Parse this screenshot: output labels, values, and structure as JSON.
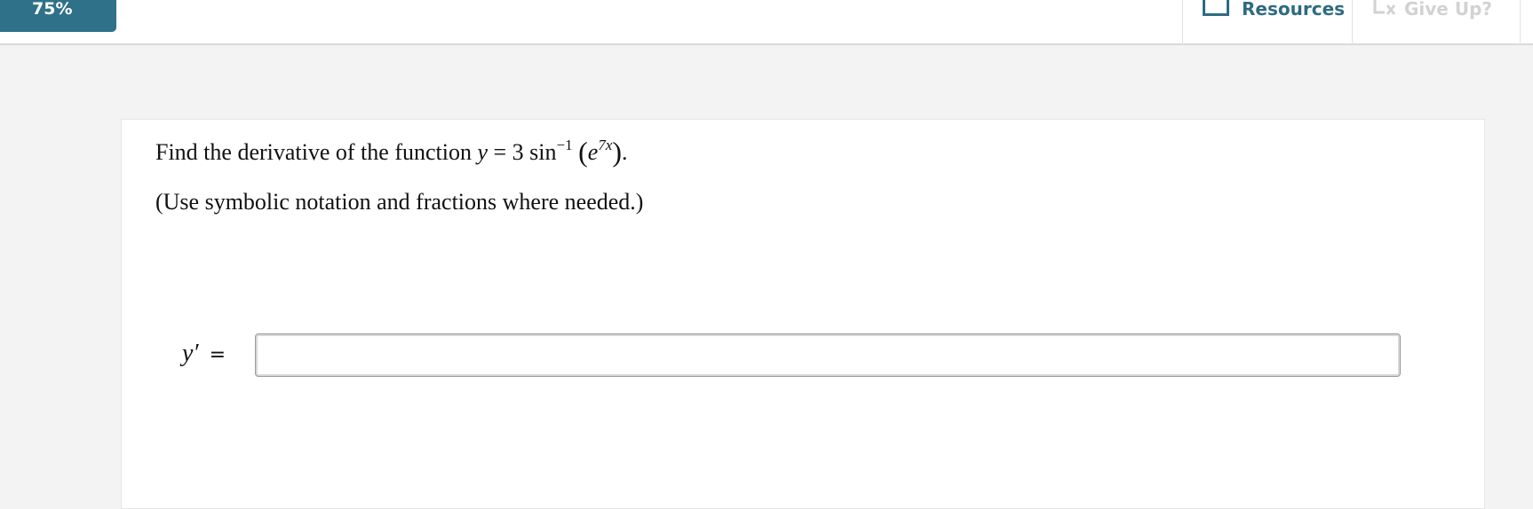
{
  "header": {
    "progress": "75%",
    "resources_label": "Resources",
    "give_up_label": "Give Up?"
  },
  "question": {
    "prefix": "Find the derivative of the function ",
    "var_y": "y",
    "equals": " = 3 sin",
    "inverse_exponent": "−1",
    "open_paren": "(",
    "base_e": "e",
    "exponent": "7x",
    "close_paren": ")",
    "period": ".",
    "instructions": "(Use symbolic notation and fractions where needed.)"
  },
  "answer": {
    "label_var": "y′",
    "label_equals": "=",
    "value": "",
    "placeholder": ""
  }
}
